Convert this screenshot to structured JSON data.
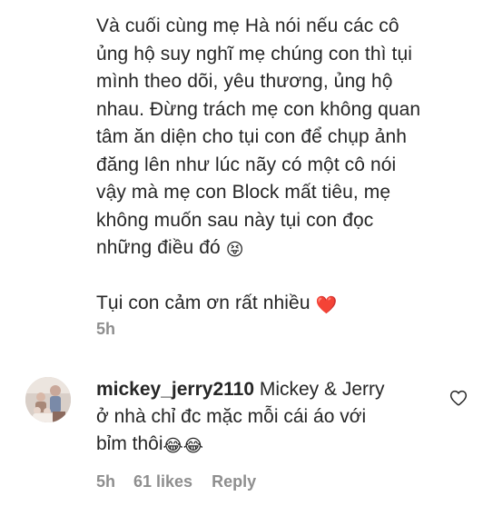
{
  "caption": {
    "lines": [
      "Và cuối cùng mẹ Hà nói nếu các cô",
      "ủng hộ suy nghĩ mẹ chúng con thì tụi",
      "mình theo dõi, yêu thương, ủng hộ",
      "nhau. Đừng trách mẹ con không quan",
      "tâm ăn diện cho tụi con để chụp ảnh",
      "đăng lên như lúc nãy có một cô nói",
      "vậy mà mẹ con Block mất tiêu, mẹ",
      "không muốn sau này tụi con đọc",
      "những điều đó"
    ],
    "emoji_tongue": "😝",
    "thanks_text": "Tụi con cảm ơn rất nhiều",
    "emoji_heart": "❤️",
    "timestamp": "5h"
  },
  "comment": {
    "username": "mickey_jerry2110",
    "text_line1": "Mickey & Jerry",
    "text_line2": "ở nhà chỉ đc mặc mỗi cái áo với",
    "text_line3": "bỉm thôi",
    "emoji_laugh": "😂😂",
    "timestamp": "5h",
    "likes": "61 likes",
    "reply_label": "Reply"
  },
  "icons": {
    "like": "heart-outline-icon",
    "avatar": "avatar"
  },
  "colors": {
    "text": "#262626",
    "secondary": "#8e8e8e",
    "heart": "#e0245e"
  }
}
